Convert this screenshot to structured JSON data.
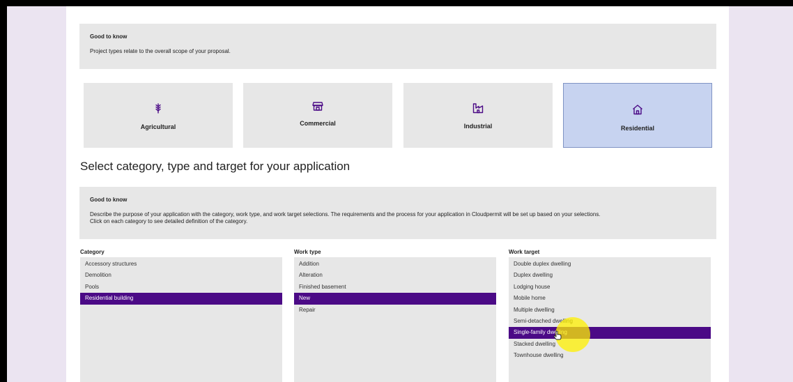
{
  "project_types": {
    "good_to_know": {
      "title": "Good to know",
      "text": "Project types relate to the overall scope of your proposal."
    },
    "cards": [
      {
        "label": "Agricultural",
        "icon": "wheat-icon"
      },
      {
        "label": "Commercial",
        "icon": "storefront-icon"
      },
      {
        "label": "Industrial",
        "icon": "factory-icon"
      },
      {
        "label": "Residential",
        "icon": "house-icon",
        "selected": true
      }
    ]
  },
  "section": {
    "title": "Select category, type and target for your application",
    "good_to_know": {
      "title": "Good to know",
      "line1": "Describe the purpose of your application with the category, work type, and work target selections. The requirements and the process for your application in Cloudpermit will be set up based on your selections.",
      "line2": "Click on each category to see detailed definition of the category."
    }
  },
  "category": {
    "title": "Category",
    "items": [
      "Accessory structures",
      "Demolition",
      "Pools",
      "Residential building"
    ],
    "selected": "Residential building"
  },
  "work_type": {
    "title": "Work type",
    "items": [
      "Addition",
      "Alteration",
      "Finished basement",
      "New",
      "Repair"
    ],
    "selected": "New"
  },
  "work_target": {
    "title": "Work target",
    "items": [
      "Double duplex dwelling",
      "Duplex dwelling",
      "Lodging house",
      "Mobile home",
      "Multiple dwelling",
      "Semi-detached dwelling",
      "Single-family dwelling",
      "Stacked dwelling",
      "Townhouse dwelling"
    ],
    "selected": "Single-family dwelling"
  },
  "colors": {
    "selected_item": "#4b0a86",
    "selected_card": "#c7d3f0",
    "panel": "#e7e7e7",
    "background": "#ebe4f1"
  }
}
